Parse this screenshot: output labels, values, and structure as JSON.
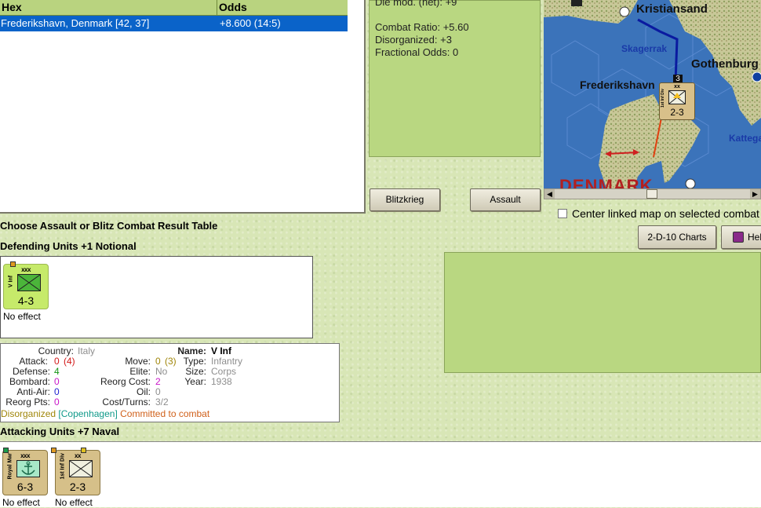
{
  "hex_table": {
    "columns": [
      "Hex",
      "Odds"
    ],
    "rows": [
      {
        "hex": "Frederikshavn, Denmark [42, 37]",
        "odds": "+8.600 (14:5)"
      }
    ]
  },
  "info_panel": {
    "die_mod": "Die mod. (net): +9",
    "combat_ratio": "Combat Ratio: +5.60",
    "disorganized": "Disorganized: +3",
    "fractional_odds": "Fractional Odds: 0"
  },
  "buttons": {
    "blitzkrieg": "Blitzkrieg",
    "assault": "Assault",
    "charts": "2-D-10 Charts",
    "help": "Help"
  },
  "map": {
    "labels": {
      "kristiansand": "Kristiansand",
      "skagerrak": "Skagerrak",
      "gothenburg": "Gothenburg",
      "frederikshavn": "Frederikshavn",
      "kattegat": "Kattegat",
      "denmark": "DENMARK"
    },
    "stack_count": "3",
    "unit": {
      "strength": "2-3",
      "echelon": "xx",
      "name": "1st Inf Div"
    }
  },
  "center_linked_label": "Center linked map on selected combat",
  "choose_text": "Choose Assault or Blitz Combat Result Table",
  "defending": {
    "title": "Defending Units +1 Notional",
    "units": [
      {
        "name": "V Inf",
        "echelon": "xxx",
        "strength": "4-3",
        "effect": "No effect"
      }
    ]
  },
  "unit_details": {
    "country_label": "Country:",
    "country": "Italy",
    "attack_label": "Attack:",
    "attack": "0",
    "attack_base": "(4)",
    "defense_label": "Defense:",
    "defense": "4",
    "bombard_label": "Bombard:",
    "bombard": "0",
    "antiair_label": "Anti-Air:",
    "antiair": "0",
    "reorg_pts_label": "Reorg Pts:",
    "reorg_pts": "0",
    "move_label": "Move:",
    "move": "0",
    "move_base": "(3)",
    "elite_label": "Elite:",
    "elite": "No",
    "reorg_cost_label": "Reorg Cost:",
    "reorg_cost": "2",
    "oil_label": "Oil:",
    "oil": "0",
    "cost_turns_label": "Cost/Turns:",
    "cost_turns": "3/2",
    "name_label": "Name:",
    "name": "V Inf",
    "type_label": "Type:",
    "type": "Infantry",
    "size_label": "Size:",
    "size": "Corps",
    "year_label": "Year:",
    "year": "1938",
    "status_disorganized": "Disorganized",
    "status_location": "[Copenhagen]",
    "status_committed": "Committed to combat"
  },
  "attacking": {
    "title": "Attacking Units +7 Naval",
    "units": [
      {
        "name": "Royal Mar",
        "echelon": "xxx",
        "strength": "6-3",
        "effect": "No effect"
      },
      {
        "name": "1st Inf Div",
        "echelon": "xx",
        "strength": "2-3",
        "effect": "No effect"
      }
    ]
  }
}
